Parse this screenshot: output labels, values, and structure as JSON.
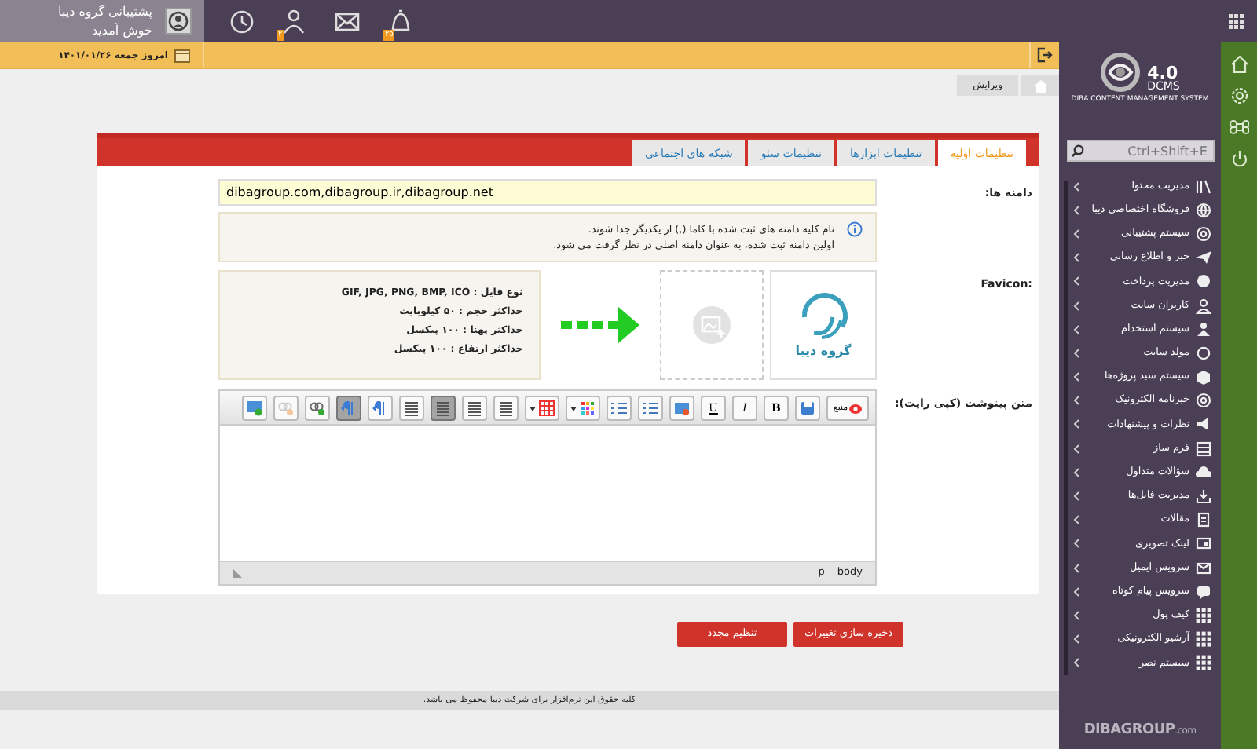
{
  "top_bar": {
    "user_name": "پشتیبانی گروه دیبا",
    "greeting": "خوش آمدید",
    "badges": [
      {
        "kind": "bell",
        "count": "۲۵"
      },
      {
        "kind": "user",
        "count": "۲"
      }
    ]
  },
  "date_bar": {
    "date": "امروز جمعه ۱۴۰۱/۰۱/۲۶"
  },
  "breadcrumb": {
    "current": "ویرایش"
  },
  "logo": {
    "version": "4.0",
    "name": "DCMS",
    "tagline": "DIBA CONTENT MANAGEMENT SYSTEM",
    "footer": "DIBAGROUP",
    "footer_suffix": ".com"
  },
  "sidebar": {
    "search": {
      "placeholder": "Ctrl+Shift+E"
    },
    "items": [
      {
        "label": "مدیریت محتوا"
      },
      {
        "label": "فروشگاه اختصاصی دیبا"
      },
      {
        "label": "سیستم پشتیبانی"
      },
      {
        "label": "خبر و اطلاع رسانی"
      },
      {
        "label": "مدیریت پرداخت"
      },
      {
        "label": "کاربران سایت"
      },
      {
        "label": "سیستم استخدام"
      },
      {
        "label": "مولد سایت"
      },
      {
        "label": "سیستم سبد پروژه‌ها"
      },
      {
        "label": "خبرنامه الکترونیک"
      },
      {
        "label": "نظرات و پیشنهادات"
      },
      {
        "label": "فرم ساز"
      },
      {
        "label": "سؤالات متداول"
      },
      {
        "label": "مدیریت فایل‌ها"
      },
      {
        "label": "مقالات"
      },
      {
        "label": "لینک تصویری"
      },
      {
        "label": "سرویس ایمیل"
      },
      {
        "label": "سرویس پیام کوتاه"
      },
      {
        "label": "کیف پول"
      },
      {
        "label": "آرشیو الکترونیکی"
      },
      {
        "label": "سیستم نصر"
      }
    ]
  },
  "tabs": [
    {
      "label": "تنظیمات اولیه",
      "selected": true
    },
    {
      "label": "تنظیمات ابزارها",
      "selected": false
    },
    {
      "label": "تنظیمات سئو",
      "selected": false
    },
    {
      "label": "شبکه های اجتماعی",
      "selected": false
    }
  ],
  "domains": {
    "label": "دامنه ها:",
    "value": "dibagroup.com,dibagroup.ir,dibagroup.net",
    "notes": [
      "نام کلیه دامنه های ثبت شده با کاما (,) از یکدیگر جدا شوند.",
      "اولین دامنه ثبت شده، به عنوان دامنه اصلی در نظر گرفت می شود."
    ]
  },
  "favicon": {
    "label": "Favicon:",
    "logo_text": "گروه دیبا",
    "rules": [
      "نوع فایل : GIF, JPG, PNG, BMP, ICO",
      "حداکثر حجم : ۵۰ کیلوبایت",
      "حداکثر پهنا : ۱۰۰ پیکسل",
      "حداکثر ارتفاع : ۱۰۰ پیکسل"
    ]
  },
  "editor": {
    "label": "متن پینوشت (کپی رایت):",
    "toolbar": [
      {
        "kind": "source",
        "label": "منبع",
        "pressed": false
      },
      {
        "kind": "save",
        "pressed": false
      },
      {
        "kind": "bold",
        "label": "B",
        "pressed": false
      },
      {
        "kind": "italic",
        "label": "I",
        "pressed": false
      },
      {
        "kind": "underline",
        "label": "U",
        "pressed": false
      },
      {
        "kind": "image",
        "pressed": false
      },
      {
        "kind": "list",
        "pressed": false
      },
      {
        "kind": "list",
        "pressed": false
      },
      {
        "kind": "colors",
        "pressed": false
      },
      {
        "kind": "table",
        "pressed": false
      },
      {
        "kind": "align",
        "pressed": false
      },
      {
        "kind": "align",
        "pressed": false
      },
      {
        "kind": "align",
        "pressed": true
      },
      {
        "kind": "align",
        "pressed": false
      },
      {
        "kind": "direction",
        "pressed": false
      },
      {
        "kind": "direction",
        "pressed": true
      },
      {
        "kind": "link",
        "pressed": false
      },
      {
        "kind": "unlink",
        "pressed": false
      },
      {
        "kind": "image_add",
        "pressed": false
      }
    ],
    "path": [
      "body",
      "p"
    ]
  },
  "buttons": [
    {
      "label": "ذخیره سازی تغییرات"
    },
    {
      "label": "تنظیم مجدد"
    }
  ],
  "footer": "کلیه حقوق این نرم‌افزار برای شرکت دیبا محفوظ می باشد."
}
